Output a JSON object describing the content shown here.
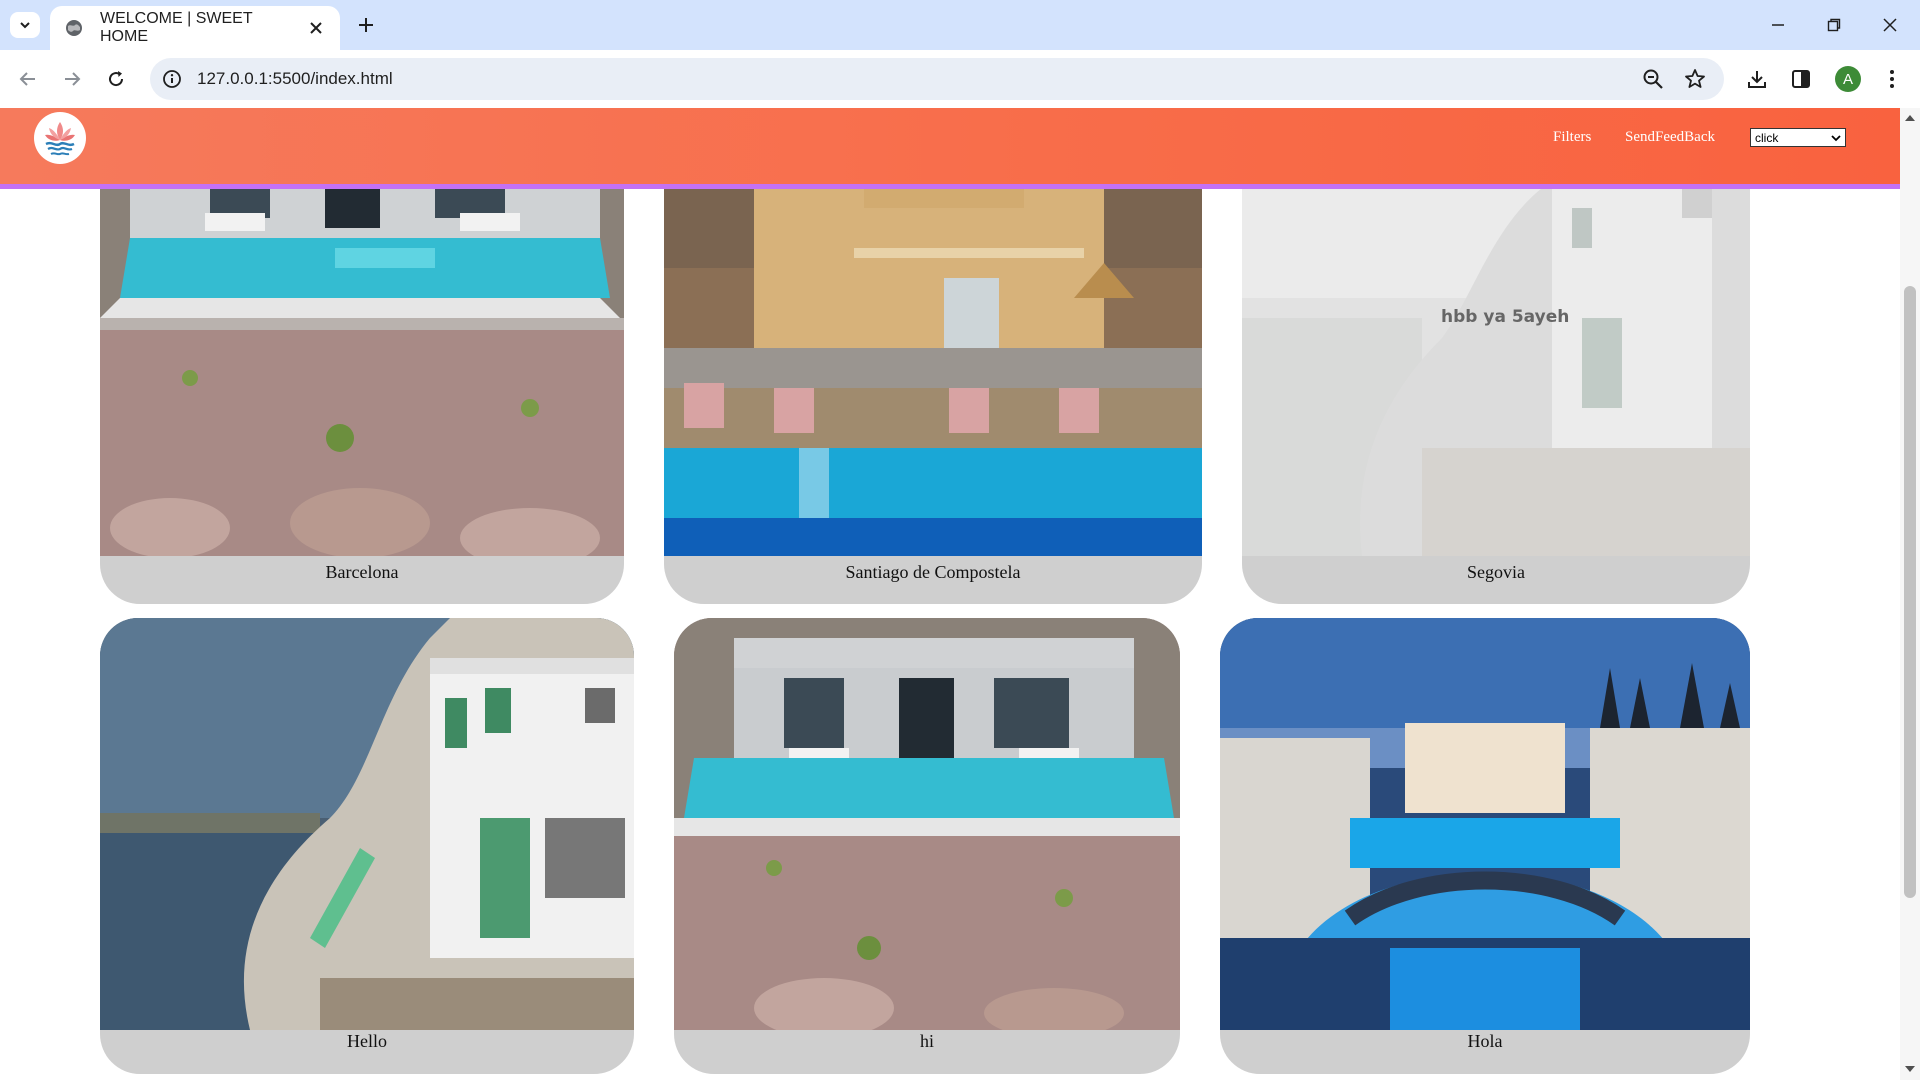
{
  "browser": {
    "tab_title": "WELCOME | SWEET HOME",
    "url": "127.0.0.1:5500/index.html",
    "avatar_letter": "A"
  },
  "site": {
    "nav": {
      "filters": "Filters",
      "feedback": "SendFeedBack",
      "select_value": "click"
    },
    "cards": [
      {
        "label": "Barcelona"
      },
      {
        "label": "Santiago de Compostela"
      },
      {
        "label": "Segovia",
        "overlay_text": "hbb ya 5ayeh"
      },
      {
        "label": "Hello"
      },
      {
        "label": "hi"
      },
      {
        "label": "Hola"
      }
    ]
  },
  "colors": {
    "header_start": "#f67a5c",
    "header_end": "#f9623f",
    "header_border": "#c471f5",
    "card_bg": "#cfcfcf"
  }
}
